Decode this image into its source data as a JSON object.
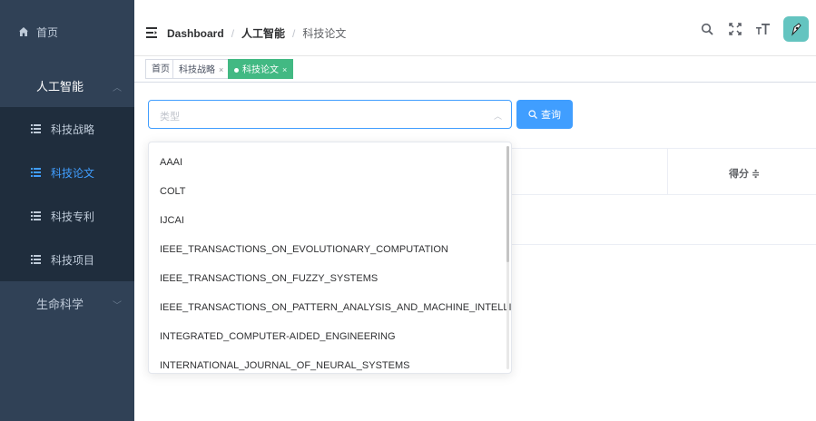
{
  "sidebar": {
    "home": "首页",
    "group_ai": "人工智能",
    "items": [
      {
        "label": "科技战略"
      },
      {
        "label": "科技论文"
      },
      {
        "label": "科技专利"
      },
      {
        "label": "科技项目"
      }
    ],
    "group_life": "生命科学"
  },
  "breadcrumb": {
    "dashboard": "Dashboard",
    "sep": "/",
    "section": "人工智能",
    "page": "科技论文"
  },
  "tags": {
    "home": "首页",
    "strategy": "科技战略",
    "papers": "科技论文",
    "close": "×"
  },
  "search": {
    "placeholder": "类型",
    "button": "查询"
  },
  "table": {
    "score_header": "得分 ≑"
  },
  "dropdown": {
    "options": [
      "AAAI",
      "COLT",
      "IJCAI",
      "IEEE_TRANSACTIONS_ON_EVOLUTIONARY_COMPUTATION",
      "IEEE_TRANSACTIONS_ON_FUZZY_SYSTEMS",
      "IEEE_TRANSACTIONS_ON_PATTERN_ANALYSIS_AND_MACHINE_INTELLIGENCE",
      "INTEGRATED_COMPUTER-AIDED_ENGINEERING",
      "INTERNATIONAL_JOURNAL_OF_NEURAL_SYSTEMS"
    ]
  },
  "colors": {
    "sidebar_bg": "#304156",
    "submenu_bg": "#1f2d3d",
    "accent": "#409eff",
    "tag_active": "#42b983",
    "avatar_bg": "#64c4c0"
  },
  "icons": [
    "home-icon",
    "chevron-up-icon",
    "list-icon",
    "chevron-down-icon",
    "hamburger-icon",
    "search-icon",
    "fullscreen-icon",
    "font-size-icon",
    "avatar-icon"
  ]
}
